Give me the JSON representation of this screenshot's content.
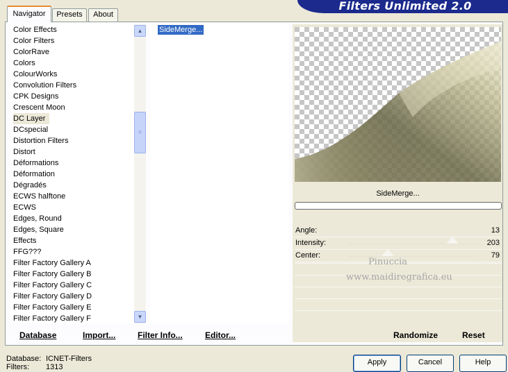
{
  "banner": {
    "title": "Filters Unlimited 2.0"
  },
  "tabs": [
    {
      "label": "Navigator",
      "active": true
    },
    {
      "label": "Presets",
      "active": false
    },
    {
      "label": "About",
      "active": false
    }
  ],
  "categories": [
    "Color Effects",
    "Color Filters",
    "ColorRave",
    "Colors",
    "ColourWorks",
    "Convolution Filters",
    "CPK Designs",
    "Crescent Moon",
    "DC Layer",
    "DCspecial",
    "Distortion Filters",
    "Distort",
    "Déformations",
    "Déformation",
    "Dégradés",
    "ECWS halftone",
    "ECWS",
    "Edges, Round",
    "Edges, Square",
    "Effects",
    "FFG???",
    "Filter Factory Gallery A",
    "Filter Factory Gallery B",
    "Filter Factory Gallery C",
    "Filter Factory Gallery D",
    "Filter Factory Gallery E",
    "Filter Factory Gallery F"
  ],
  "selected_category": "DC Layer",
  "filters": [
    "SideMerge..."
  ],
  "preview": {
    "filter_name": "SideMerge...",
    "progress": 0
  },
  "params": [
    {
      "label": "Angle:",
      "value": "13"
    },
    {
      "label": "Intensity:",
      "value": "203",
      "slider_fraction": 0.8
    },
    {
      "label": "Center:",
      "value": "79",
      "slider_fraction": 0.31
    }
  ],
  "watermark": {
    "line1": "Pinuccia",
    "line2": "www.maidiregrafica.eu"
  },
  "bottom_links": {
    "database": "Database",
    "import": "Import...",
    "filter_info": "Filter Info...",
    "editor": "Editor...",
    "randomize": "Randomize",
    "reset": "Reset"
  },
  "status": {
    "database_label": "Database:",
    "database_value": "ICNET-Filters",
    "filters_label": "Filters:",
    "filters_value": "1313"
  },
  "buttons": {
    "apply": "Apply",
    "cancel": "Cancel",
    "help": "Help"
  },
  "colors": {
    "banner": "#1b2a8c",
    "selection": "#316ac5",
    "tab_highlight": "#e68b2c"
  },
  "icons": {
    "scroll_up": "chevron-up-icon",
    "scroll_down": "chevron-down-icon"
  }
}
